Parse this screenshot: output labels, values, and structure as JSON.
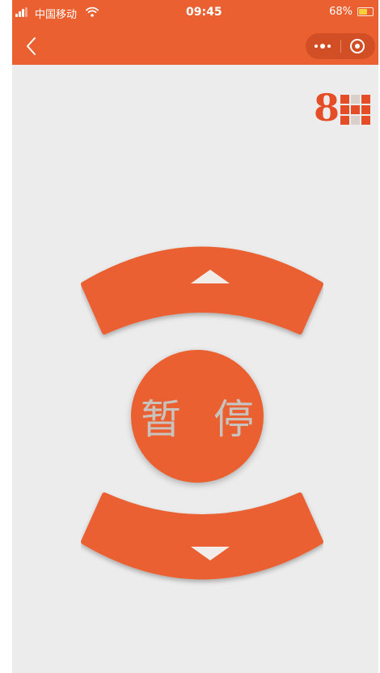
{
  "status_bar": {
    "carrier": "中国移动",
    "time": "09:45",
    "battery_percent": "68%",
    "battery_level": 0.68,
    "signal_icon": "signal-icon",
    "wifi_icon": "wifi-icon",
    "battery_icon": "battery-icon"
  },
  "nav_bar": {
    "back_icon": "chevron-left-icon",
    "more_icon": "more-dots-icon",
    "close_icon": "target-circle-icon"
  },
  "logo": {
    "text": "8"
  },
  "controls": {
    "up_icon": "triangle-up-icon",
    "down_icon": "triangle-down-icon",
    "pause_label": "暂 停"
  },
  "colors": {
    "accent": "#ea6030",
    "logo": "#e44d26",
    "background": "#ececec",
    "pause_text": "#c9c3c0"
  }
}
